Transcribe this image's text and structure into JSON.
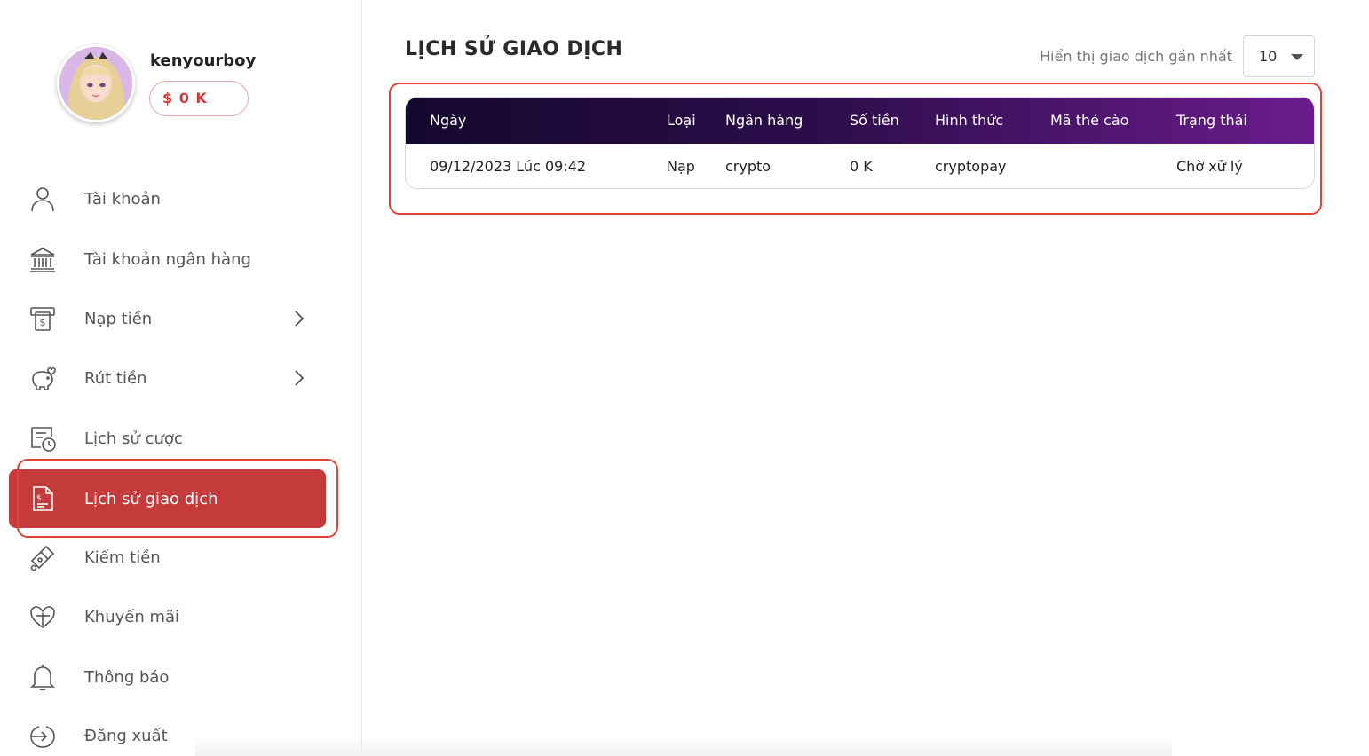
{
  "profile": {
    "username": "kenyourboy",
    "balance": "$ 0 K"
  },
  "sidebar": {
    "items": [
      {
        "label": "Tài khoản",
        "icon": "user-icon"
      },
      {
        "label": "Tài khoản ngân hàng",
        "icon": "bank-icon"
      },
      {
        "label": "Nạp tiền",
        "icon": "atm-deposit-icon",
        "has_chevron": true
      },
      {
        "label": "Rút tiền",
        "icon": "piggy-bank-icon",
        "has_chevron": true
      },
      {
        "label": "Lịch sử cược",
        "icon": "bet-history-icon"
      },
      {
        "label": "Lịch sử giao dịch",
        "icon": "transaction-history-icon",
        "active": true
      },
      {
        "label": "Kiếm tiền",
        "icon": "earn-money-icon"
      },
      {
        "label": "Khuyến mãi",
        "icon": "promotion-gift-icon"
      },
      {
        "label": "Thông báo",
        "icon": "bell-icon"
      },
      {
        "label": "Đăng xuất",
        "icon": "logout-icon"
      }
    ]
  },
  "main": {
    "title": "LỊCH SỬ GIAO DỊCH",
    "show_label": "Hiển thị giao dịch gần nhất",
    "show_count": "10",
    "table": {
      "headers": [
        "Ngày",
        "Loại",
        "Ngân hàng",
        "Số tiền",
        "Hình thức",
        "Mã thẻ cào",
        "Trạng thái"
      ],
      "rows": [
        [
          "09/12/2023 Lúc 09:42",
          "Nạp",
          "crypto",
          "0 K",
          "cryptopay",
          "",
          "Chờ xử lý"
        ]
      ]
    }
  },
  "colors": {
    "accent_red": "#c53a3a",
    "highlight_red": "#e04236",
    "header_gradient_start": "#14082e",
    "header_gradient_end": "#6a1c8c"
  }
}
